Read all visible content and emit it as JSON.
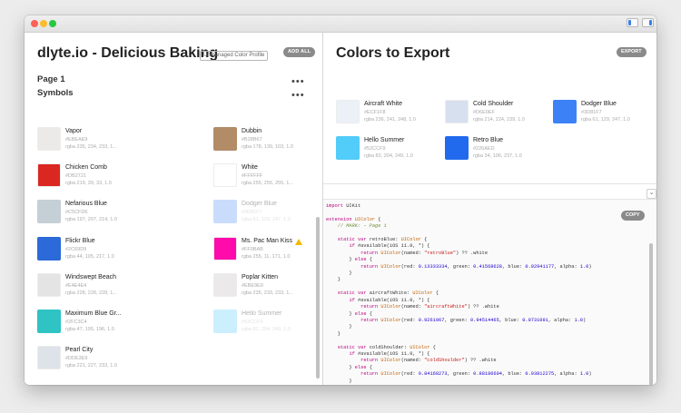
{
  "window": {
    "traffic_lights": [
      "close",
      "minimize",
      "zoom"
    ]
  },
  "left": {
    "title": "dlyte.io - Delicious Baking",
    "badge": "Unmanaged Color Profile",
    "add_all": "ADD ALL",
    "page_label": "Page 1",
    "symbols_label": "Symbols",
    "more": "•••",
    "left_column": [
      {
        "name": "Vapor",
        "hex": "#EBEAE9",
        "rgba": "rgba 235, 234, 233, 1...",
        "color": "#EBEAE9"
      },
      {
        "name": "Chicken Comb",
        "hex": "#DB2721",
        "rgba": "rgba 219, 39, 33, 1.0",
        "color": "#DB2721"
      },
      {
        "name": "Nefarious Blue",
        "hex": "#C5CFD6",
        "rgba": "rgba 197, 207, 214, 1.0",
        "color": "#C5CFD6"
      },
      {
        "name": "Flickr Blue",
        "hex": "#2C69D9",
        "rgba": "rgba 44, 105, 217, 1.0",
        "color": "#2C69D9"
      },
      {
        "name": "Windswept Beach",
        "hex": "#E4E4E4",
        "rgba": "rgba 228, 228, 228, 1...",
        "color": "#E4E4E4"
      },
      {
        "name": "Maximum Blue Gr...",
        "hex": "#2FC3C4",
        "rgba": "rgba 47, 195, 196, 1.0",
        "color": "#2FC3C4"
      },
      {
        "name": "Pearl City",
        "hex": "#DDE3E9",
        "rgba": "rgba 221, 227, 233, 1.0",
        "color": "#DDE3E9"
      }
    ],
    "right_column": [
      {
        "name": "Dubbin",
        "hex": "#B28B67",
        "rgba": "rgba 178, 139, 103, 1.0",
        "color": "#B28B67"
      },
      {
        "name": "White",
        "hex": "#FFFFFF",
        "rgba": "rgba 255, 255, 255, 1...",
        "color": "#FFFFFF"
      },
      {
        "name": "Dodger Blue",
        "hex": "#3D81F7",
        "rgba": "rgba 61, 129, 247, 1.0",
        "color": "#C9DCFB"
      },
      {
        "name": "Ms. Pac Man Kiss",
        "hex": "#FF0BAB",
        "rgba": "rgba 255, 11, 171, 1.0",
        "color": "#FF0BAB"
      },
      {
        "name": "Poplar Kitten",
        "hex": "#EBE9E9",
        "rgba": "rgba 235, 233, 233, 1...",
        "color": "#EBE9E9"
      },
      {
        "name": "Hello Summer",
        "hex": "#52CCF9",
        "rgba": "rgba 82, 204, 249, 1.0",
        "color": "#CCEFFD"
      }
    ]
  },
  "right": {
    "title": "Colors to Export",
    "export": "EXPORT",
    "colors": [
      {
        "name": "Aircraft White",
        "hex": "#ECF1F8",
        "rgba": "rgba 236, 241, 248, 1.0",
        "color": "#ECF1F8"
      },
      {
        "name": "Cold Shoulder",
        "hex": "#D6E0EF",
        "rgba": "rgba 214, 224, 239, 1.0",
        "color": "#D6E0EF"
      },
      {
        "name": "Dodger Blue",
        "hex": "#3D81F7",
        "rgba": "rgba 61, 129, 247, 1.0",
        "color": "#3D81F7"
      },
      {
        "name": "Hello Summer",
        "hex": "#52CCF9",
        "rgba": "rgba 82, 204, 249, 1.0",
        "color": "#52CCF9"
      },
      {
        "name": "Retro Blue",
        "hex": "#226AED",
        "rgba": "rgba 34, 106, 237, 1.0",
        "color": "#226AED"
      }
    ],
    "chevron": "⌄",
    "copy": "COPY"
  },
  "code_lines": [
    [
      [
        "kw",
        "import"
      ],
      [
        "p",
        " UIKit"
      ]
    ],
    [],
    [
      [
        "kw",
        "extension"
      ],
      [
        "p",
        " "
      ],
      [
        "ty",
        "UIColor"
      ],
      [
        "p",
        " {"
      ]
    ],
    [
      [
        "cm",
        "    // MARK: - Page 1"
      ]
    ],
    [],
    [
      [
        "p",
        "    "
      ],
      [
        "kw",
        "static var"
      ],
      [
        "p",
        " retroBlue: "
      ],
      [
        "ty",
        "UIColor"
      ],
      [
        "p",
        " {"
      ]
    ],
    [
      [
        "p",
        "        "
      ],
      [
        "kw",
        "if"
      ],
      [
        "p",
        " #available(iOS 11.0, *) {"
      ]
    ],
    [
      [
        "p",
        "            "
      ],
      [
        "kw",
        "return"
      ],
      [
        "p",
        " "
      ],
      [
        "ty",
        "UIColor"
      ],
      [
        "p",
        "(named: "
      ],
      [
        "str",
        "\"retroBlue\""
      ],
      [
        "p",
        ") ?? .white"
      ]
    ],
    [
      [
        "p",
        "        } "
      ],
      [
        "kw",
        "else"
      ],
      [
        "p",
        " {"
      ]
    ],
    [
      [
        "p",
        "            "
      ],
      [
        "kw",
        "return"
      ],
      [
        "p",
        " "
      ],
      [
        "ty",
        "UIColor"
      ],
      [
        "p",
        "(red: "
      ],
      [
        "num",
        "0.13333334"
      ],
      [
        "p",
        ", green: "
      ],
      [
        "num",
        "0.41568628"
      ],
      [
        "p",
        ", blue: "
      ],
      [
        "num",
        "0.92941177"
      ],
      [
        "p",
        ", alpha: "
      ],
      [
        "num",
        "1.0"
      ],
      [
        "p",
        ")"
      ]
    ],
    [
      [
        "p",
        "        }"
      ]
    ],
    [
      [
        "p",
        "    }"
      ]
    ],
    [],
    [
      [
        "p",
        "    "
      ],
      [
        "kw",
        "static var"
      ],
      [
        "p",
        " aircraftWhite: "
      ],
      [
        "ty",
        "UIColor"
      ],
      [
        "p",
        " {"
      ]
    ],
    [
      [
        "p",
        "        "
      ],
      [
        "kw",
        "if"
      ],
      [
        "p",
        " #available(iOS 11.0, *) {"
      ]
    ],
    [
      [
        "p",
        "            "
      ],
      [
        "kw",
        "return"
      ],
      [
        "p",
        " "
      ],
      [
        "ty",
        "UIColor"
      ],
      [
        "p",
        "(named: "
      ],
      [
        "str",
        "\"aircraftWhite\""
      ],
      [
        "p",
        ") ?? .white"
      ]
    ],
    [
      [
        "p",
        "        } "
      ],
      [
        "kw",
        "else"
      ],
      [
        "p",
        " {"
      ]
    ],
    [
      [
        "p",
        "            "
      ],
      [
        "kw",
        "return"
      ],
      [
        "p",
        " "
      ],
      [
        "ty",
        "UIColor"
      ],
      [
        "p",
        "(red: "
      ],
      [
        "num",
        "0.9261967"
      ],
      [
        "p",
        ", green: "
      ],
      [
        "num",
        "0.94514465"
      ],
      [
        "p",
        ", blue: "
      ],
      [
        "num",
        "0.9731091"
      ],
      [
        "p",
        ", alpha: "
      ],
      [
        "num",
        "1.0"
      ],
      [
        "p",
        ")"
      ]
    ],
    [
      [
        "p",
        "        }"
      ]
    ],
    [
      [
        "p",
        "    }"
      ]
    ],
    [],
    [
      [
        "p",
        "    "
      ],
      [
        "kw",
        "static var"
      ],
      [
        "p",
        " coldShoulder: "
      ],
      [
        "ty",
        "UIColor"
      ],
      [
        "p",
        " {"
      ]
    ],
    [
      [
        "p",
        "        "
      ],
      [
        "kw",
        "if"
      ],
      [
        "p",
        " #available(iOS 11.0, *) {"
      ]
    ],
    [
      [
        "p",
        "            "
      ],
      [
        "kw",
        "return"
      ],
      [
        "p",
        " "
      ],
      [
        "ty",
        "UIColor"
      ],
      [
        "p",
        "(named: "
      ],
      [
        "str",
        "\"coldShoulder\""
      ],
      [
        "p",
        ") ?? .white"
      ]
    ],
    [
      [
        "p",
        "        } "
      ],
      [
        "kw",
        "else"
      ],
      [
        "p",
        " {"
      ]
    ],
    [
      [
        "p",
        "            "
      ],
      [
        "kw",
        "return"
      ],
      [
        "p",
        " "
      ],
      [
        "ty",
        "UIColor"
      ],
      [
        "p",
        "(red: "
      ],
      [
        "num",
        "0.84168273"
      ],
      [
        "p",
        ", green: "
      ],
      [
        "num",
        "0.88186604"
      ],
      [
        "p",
        ", blue: "
      ],
      [
        "num",
        "0.93812275"
      ],
      [
        "p",
        ", alpha: "
      ],
      [
        "num",
        "1.0"
      ],
      [
        "p",
        ")"
      ]
    ],
    [
      [
        "p",
        "        }"
      ]
    ],
    [
      [
        "p",
        "    }"
      ]
    ]
  ]
}
